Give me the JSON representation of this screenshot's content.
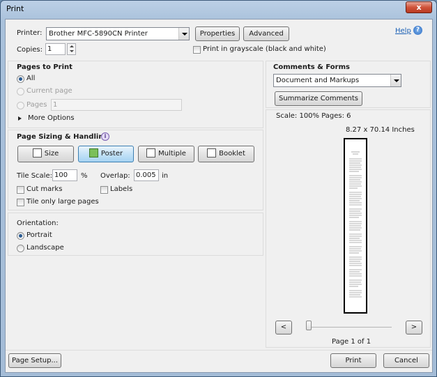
{
  "window": {
    "title": "Print",
    "close_label": "x"
  },
  "top": {
    "printer_label": "Printer:",
    "printer_value": "Brother MFC-5890CN Printer",
    "properties_label": "Properties",
    "advanced_label": "Advanced",
    "help_label": "Help",
    "copies_label": "Copies:",
    "copies_value": "1",
    "grayscale_label": "Print in grayscale (black and white)"
  },
  "pages_to_print": {
    "title": "Pages to Print",
    "all_label": "All",
    "current_page_label": "Current page",
    "pages_label": "Pages",
    "pages_value": "1",
    "more_options_label": "More Options"
  },
  "sizing": {
    "title": "Page Sizing & Handling",
    "size_label": "Size",
    "poster_label": "Poster",
    "multiple_label": "Multiple",
    "booklet_label": "Booklet",
    "tile_scale_label": "Tile Scale:",
    "tile_scale_value": "100",
    "percent_label": "%",
    "overlap_label": "Overlap:",
    "overlap_value": "0.005",
    "overlap_unit": "in",
    "cut_marks_label": "Cut marks",
    "labels_label": "Labels",
    "tile_large_label": "Tile only large pages"
  },
  "orientation": {
    "title": "Orientation:",
    "portrait_label": "Portrait",
    "landscape_label": "Landscape"
  },
  "comments": {
    "title": "Comments & Forms",
    "value": "Document and Markups",
    "summarize_label": "Summarize Comments"
  },
  "preview": {
    "scale_text": "Scale: 100% Pages: 6",
    "dimensions_text": "8.27 x 70.14 Inches",
    "prev_label": "<",
    "next_label": ">",
    "page_text": "Page 1 of 1",
    "slider_fraction": 0
  },
  "bottom": {
    "page_setup_label": "Page Setup...",
    "print_label": "Print",
    "cancel_label": "Cancel"
  },
  "colors": {
    "link": "#1a5fb4",
    "accent": "#3c7fb1"
  }
}
